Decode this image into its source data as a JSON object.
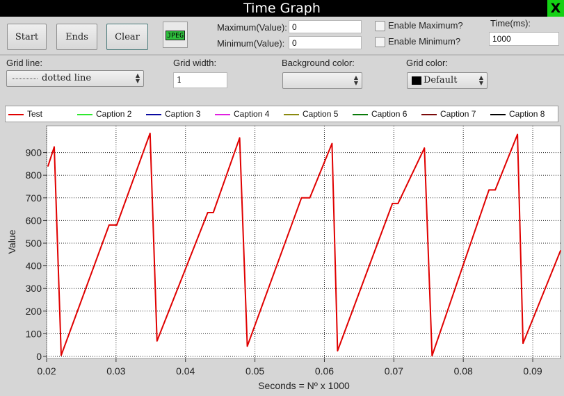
{
  "window": {
    "title": "Time Graph",
    "close_label": "X"
  },
  "toolbar": {
    "start_label": "Start",
    "ends_label": "Ends",
    "clear_label": "Clear",
    "jpeg_label": "JPEG",
    "maximum_label": "Maximum(Value):",
    "maximum_value": "0",
    "minimum_label": "Minimum(Value):",
    "minimum_value": "0",
    "enable_max_label": "Enable Maximum?",
    "enable_min_label": "Enable Minimum?",
    "time_label": "Time(ms):",
    "time_value": "1000"
  },
  "settings": {
    "grid_line_label": "Grid line:",
    "grid_line_value": "dotted line",
    "grid_width_label": "Grid width:",
    "grid_width_value": "1",
    "background_color_label": "Background color:",
    "grid_color_label": "Grid color:",
    "grid_color_value": "Default"
  },
  "chart_data": {
    "type": "line",
    "xlabel": "Seconds = Nº x 1000",
    "ylabel": "Value",
    "xlim": [
      0.02,
      0.094
    ],
    "ylim": [
      0,
      1000
    ],
    "x_ticks": [
      "0.02",
      "0.03",
      "0.04",
      "0.05",
      "0.06",
      "0.07",
      "0.08",
      "0.09"
    ],
    "y_ticks": [
      "0",
      "100",
      "200",
      "300",
      "400",
      "500",
      "600",
      "700",
      "800",
      "900"
    ],
    "grid": "dotted",
    "legend_position": "top",
    "series": [
      {
        "name": "Test",
        "color": "#e00000",
        "x": [
          0.0202,
          0.0211,
          0.0221,
          0.029,
          0.0301,
          0.0349,
          0.0359,
          0.0432,
          0.044,
          0.0478,
          0.0489,
          0.0567,
          0.0579,
          0.0611,
          0.0619,
          0.0698,
          0.0706,
          0.0744,
          0.0755,
          0.0837,
          0.0846,
          0.0878,
          0.0886,
          0.094
        ],
        "values": [
          840,
          925,
          5,
          580,
          580,
          985,
          68,
          635,
          635,
          965,
          45,
          700,
          700,
          940,
          25,
          675,
          675,
          920,
          3,
          735,
          735,
          980,
          58,
          467
        ]
      },
      {
        "name": "Caption 2",
        "color": "#2ee82e",
        "x": [],
        "values": []
      },
      {
        "name": "Caption 3",
        "color": "#0a0aa0",
        "x": [],
        "values": []
      },
      {
        "name": "Caption 4",
        "color": "#e020e0",
        "x": [],
        "values": []
      },
      {
        "name": "Caption 5",
        "color": "#8a8a10",
        "x": [],
        "values": []
      },
      {
        "name": "Caption 6",
        "color": "#0a7a0a",
        "x": [],
        "values": []
      },
      {
        "name": "Caption 7",
        "color": "#7a0a0a",
        "x": [],
        "values": []
      },
      {
        "name": "Caption 8",
        "color": "#000000",
        "x": [],
        "values": []
      }
    ]
  }
}
